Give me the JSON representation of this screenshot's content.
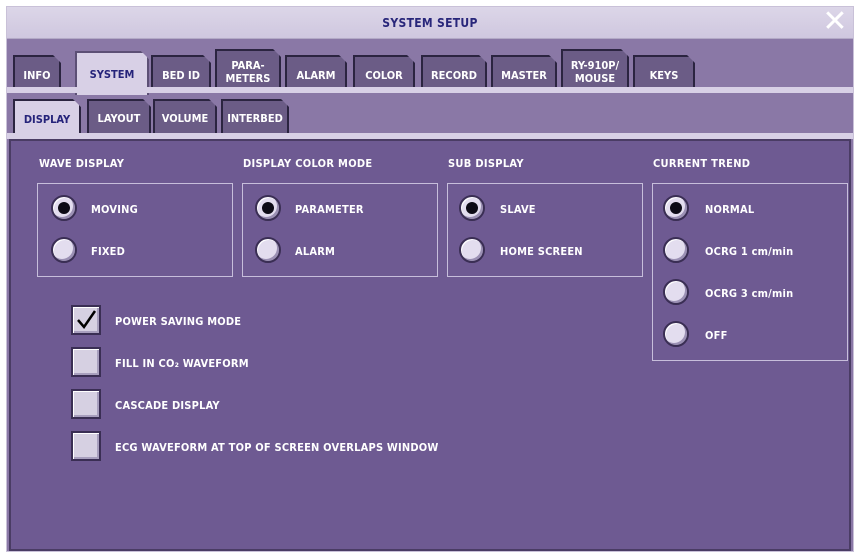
{
  "window": {
    "title": "SYSTEM SETUP"
  },
  "tabs": [
    "INFO",
    "SYSTEM",
    "BED ID",
    "PARA-\nMETERS",
    "ALARM",
    "COLOR",
    "RECORD",
    "MASTER",
    "RY-910P/\nMOUSE",
    "KEYS"
  ],
  "active_tab": "SYSTEM",
  "subtabs": [
    "DISPLAY",
    "LAYOUT",
    "VOLUME",
    "INTERBED"
  ],
  "active_subtab": "DISPLAY",
  "wave_display": {
    "title": "WAVE DISPLAY",
    "options": [
      "MOVING",
      "FIXED"
    ],
    "selected": "MOVING"
  },
  "display_color_mode": {
    "title": "DISPLAY COLOR MODE",
    "options": [
      "PARAMETER",
      "ALARM"
    ],
    "selected": "PARAMETER"
  },
  "sub_display": {
    "title": "SUB DISPLAY",
    "options": [
      "SLAVE",
      "HOME SCREEN"
    ],
    "selected": "SLAVE"
  },
  "current_trend": {
    "title": "CURRENT TREND",
    "options": [
      "NORMAL",
      "OCRG 1 cm/min",
      "OCRG 3 cm/min",
      "OFF"
    ],
    "selected": "NORMAL"
  },
  "checkboxes": [
    {
      "label": "POWER SAVING MODE",
      "checked": true
    },
    {
      "label": "FILL IN CO₂ WAVEFORM",
      "checked": false
    },
    {
      "label": "CASCADE DISPLAY",
      "checked": false
    },
    {
      "label": "ECG WAVEFORM AT TOP OF SCREEN OVERLAPS WINDOW",
      "checked": false
    }
  ],
  "colors": {
    "panel": "#6e5a92",
    "active_tab": "#d8d0e6",
    "title_text": "#28267a"
  }
}
